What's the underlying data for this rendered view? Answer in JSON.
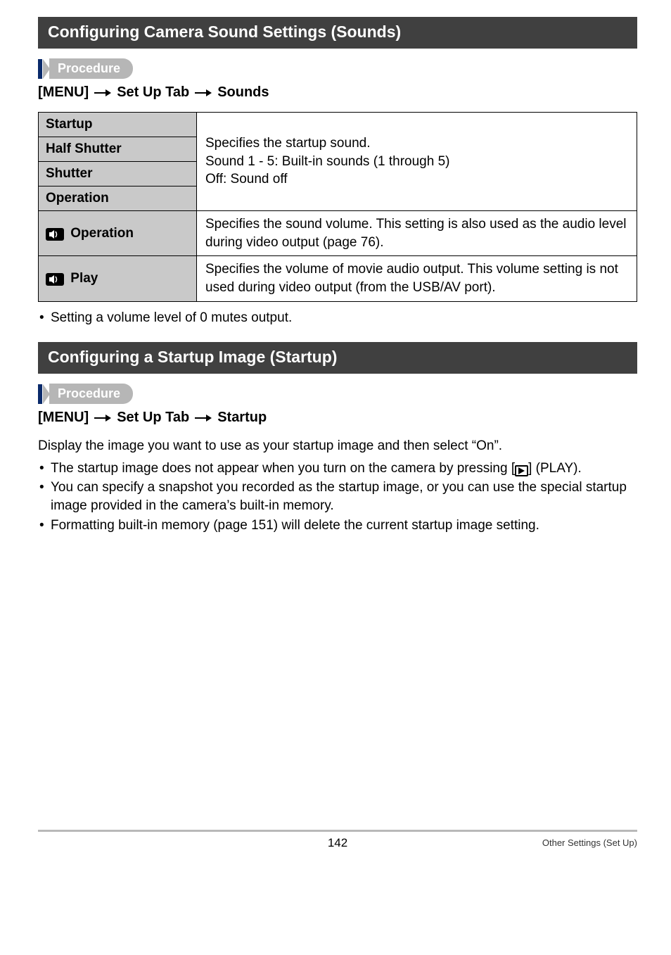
{
  "section1": {
    "title": "Configuring Camera Sound Settings (Sounds)",
    "procedure_label": "Procedure",
    "menupath": {
      "p1": "[MENU]",
      "p2": "Set Up Tab",
      "p3": "Sounds"
    },
    "table": {
      "r_startup": "Startup",
      "r_half": "Half Shutter",
      "r_shutter": "Shutter",
      "r_operation": "Operation",
      "r_op_vol": "Operation",
      "r_play": "Play",
      "desc_sounds_l1": "Specifies the startup sound.",
      "desc_sounds_l2": "Sound 1 - 5: Built-in sounds (1 through 5)",
      "desc_sounds_l3": "Off: Sound off",
      "desc_opvol": "Specifies the sound volume. This setting is also used as the audio level during video output (page 76).",
      "desc_play": "Specifies the volume of movie audio output. This volume setting is not used during video output (from the USB/AV port)."
    },
    "note": "Setting a volume level of 0 mutes output."
  },
  "section2": {
    "title": "Configuring a Startup Image (Startup)",
    "procedure_label": "Procedure",
    "menupath": {
      "p1": "[MENU]",
      "p2": "Set Up Tab",
      "p3": "Startup"
    },
    "intro": "Display the image you want to use as your startup image and then select “On”.",
    "b1a": "The startup image does not appear when you turn on the camera by pressing [",
    "b1b": "] (PLAY).",
    "b2": "You can specify a snapshot you recorded as the startup image, or you can use the special startup image provided in the camera’s built-in memory.",
    "b3": "Formatting built-in memory (page 151) will delete the current startup image setting."
  },
  "footer": {
    "page": "142",
    "section": "Other Settings (Set Up)"
  }
}
